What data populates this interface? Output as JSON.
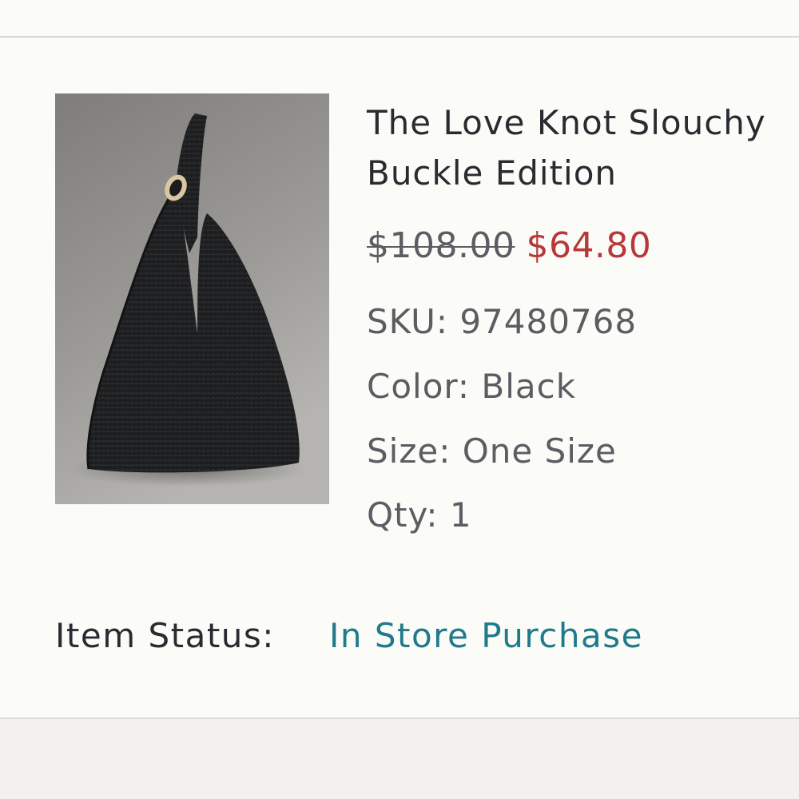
{
  "product": {
    "title_line1": "The Love Knot Slouchy",
    "title_line2": "Buckle Edition",
    "price_original": "$108.00",
    "price_sale": "$64.80",
    "sku": "SKU: 97480768",
    "color": "Color: Black",
    "size": "Size: One Size",
    "qty": "Qty: 1"
  },
  "status": {
    "label": "Item Status:",
    "value": "In Store Purchase"
  },
  "colors": {
    "sale_price": "#b8383a",
    "status_link": "#1f7a8c",
    "text_primary": "#2a2b30",
    "text_secondary": "#5c5d62"
  }
}
